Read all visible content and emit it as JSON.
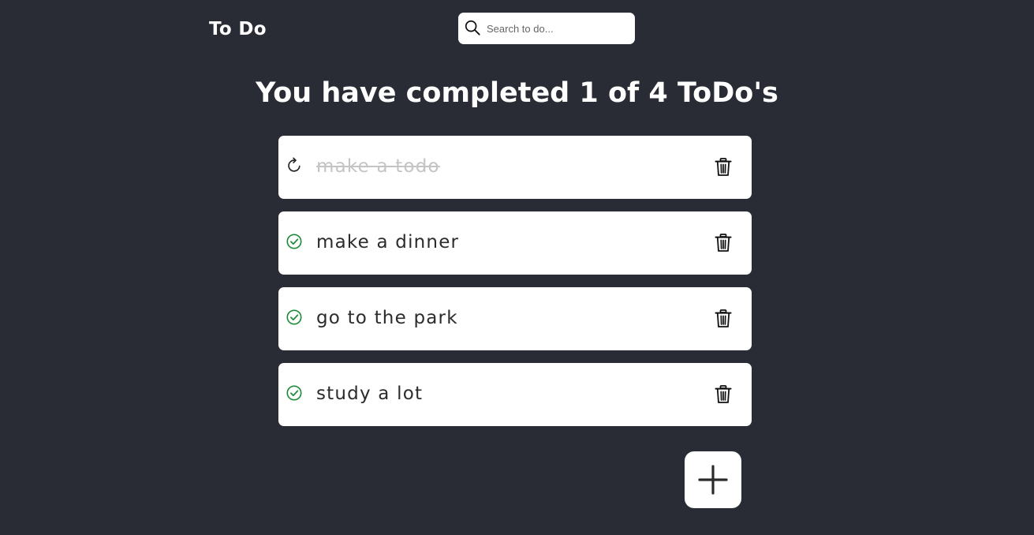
{
  "header": {
    "title": "To Do",
    "search": {
      "placeholder": "Search to do...",
      "value": "",
      "icon": "search-icon"
    }
  },
  "summary": {
    "text": "You have completed 1 of 4 ToDo's",
    "completed": 1,
    "total": 4
  },
  "todos": [
    {
      "text": "make a todo",
      "completed": true,
      "status_icon": "undo-icon",
      "delete_icon": "trash-icon"
    },
    {
      "text": "make a dinner",
      "completed": false,
      "status_icon": "check-circle-icon",
      "delete_icon": "trash-icon"
    },
    {
      "text": "go to the park",
      "completed": false,
      "status_icon": "check-circle-icon",
      "delete_icon": "trash-icon"
    },
    {
      "text": "study a lot",
      "completed": false,
      "status_icon": "check-circle-icon",
      "delete_icon": "trash-icon"
    }
  ],
  "add_button": {
    "icon": "plus-icon"
  },
  "colors": {
    "background": "#292c34",
    "card": "#ffffff",
    "check": "#1f8a3a",
    "completed_text": "#c4c4c4",
    "text": "#2b2b2b"
  }
}
